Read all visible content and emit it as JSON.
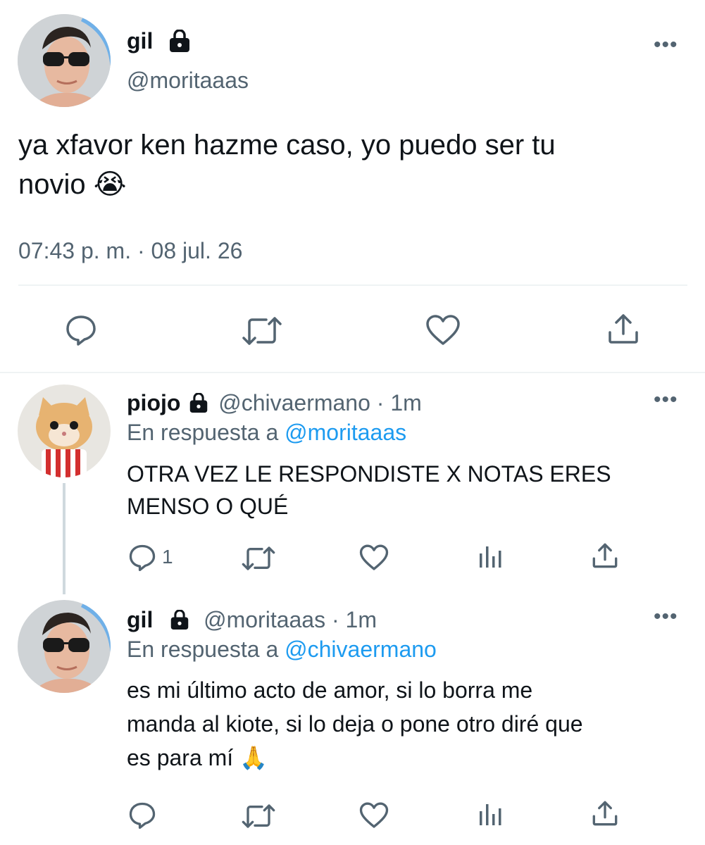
{
  "main_tweet": {
    "display_name": "gil",
    "handle": "@moritaaas",
    "text": "ya xfavor ken hazme caso, yo puedo ser tu",
    "text_line2": "novio",
    "emoji": "😭",
    "timestamp": "07:43 p. m. · 08 jul. 26",
    "icons": [
      "reply-icon",
      "retweet-icon",
      "like-icon",
      "share-icon"
    ]
  },
  "reply1": {
    "display_name": "piojo",
    "handle": "@chivaermano",
    "time": "· 1m",
    "reply_prefix": "En respuesta a",
    "reply_to": "@moritaaas",
    "text_line1": "OTRA VEZ LE RESPONDISTE X NOTAS ERES",
    "text_line2": "MENSO O QUÉ",
    "reply_count": "1"
  },
  "reply2": {
    "display_name": "gil",
    "handle": "@moritaaas",
    "time": "· 1m",
    "reply_prefix": "En respuesta a",
    "reply_to": "@chivaermano",
    "text_line1": "es mi último acto de amor, si lo borra me",
    "text_line2": "manda al kiote, si lo deja o pone otro diré que",
    "text_line3": "es para mí",
    "emoji": "🙏"
  },
  "colors": {
    "text": "#0f1419",
    "secondary": "#536471",
    "link": "#1d9bf0",
    "divider": "#eff3f4"
  }
}
